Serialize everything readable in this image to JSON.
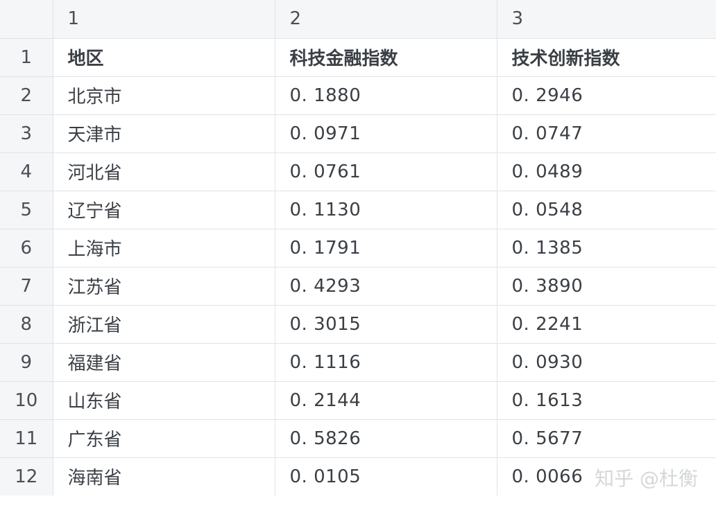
{
  "column_headers": [
    "1",
    "2",
    "3"
  ],
  "rows": [
    {
      "row_number": "1",
      "cells": [
        "地区",
        "科技金融指数",
        "技术创新指数"
      ]
    },
    {
      "row_number": "2",
      "cells": [
        "北京市",
        "0. 1880",
        "0. 2946"
      ]
    },
    {
      "row_number": "3",
      "cells": [
        "天津市",
        "0. 0971",
        "0. 0747"
      ]
    },
    {
      "row_number": "4",
      "cells": [
        "河北省",
        "0. 0761",
        "0. 0489"
      ]
    },
    {
      "row_number": "5",
      "cells": [
        "辽宁省",
        "0. 1130",
        "0. 0548"
      ]
    },
    {
      "row_number": "6",
      "cells": [
        "上海市",
        "0. 1791",
        "0. 1385"
      ]
    },
    {
      "row_number": "7",
      "cells": [
        "江苏省",
        "0. 4293",
        "0. 3890"
      ]
    },
    {
      "row_number": "8",
      "cells": [
        "浙江省",
        "0. 3015",
        "0. 2241"
      ]
    },
    {
      "row_number": "9",
      "cells": [
        "福建省",
        "0. 1116",
        "0. 0930"
      ]
    },
    {
      "row_number": "10",
      "cells": [
        "山东省",
        "0. 2144",
        "0. 1613"
      ]
    },
    {
      "row_number": "11",
      "cells": [
        "广东省",
        "0. 5826",
        "0. 5677"
      ]
    },
    {
      "row_number": "12",
      "cells": [
        "海南省",
        "0. 0105",
        "0. 0066"
      ]
    }
  ],
  "watermark": "知乎 @杜衡",
  "colors": {
    "header_background": "#f4f6f8",
    "gridline": "#dfe3e8",
    "text": "#3a3f45",
    "watermark": "#cdd0d4"
  }
}
